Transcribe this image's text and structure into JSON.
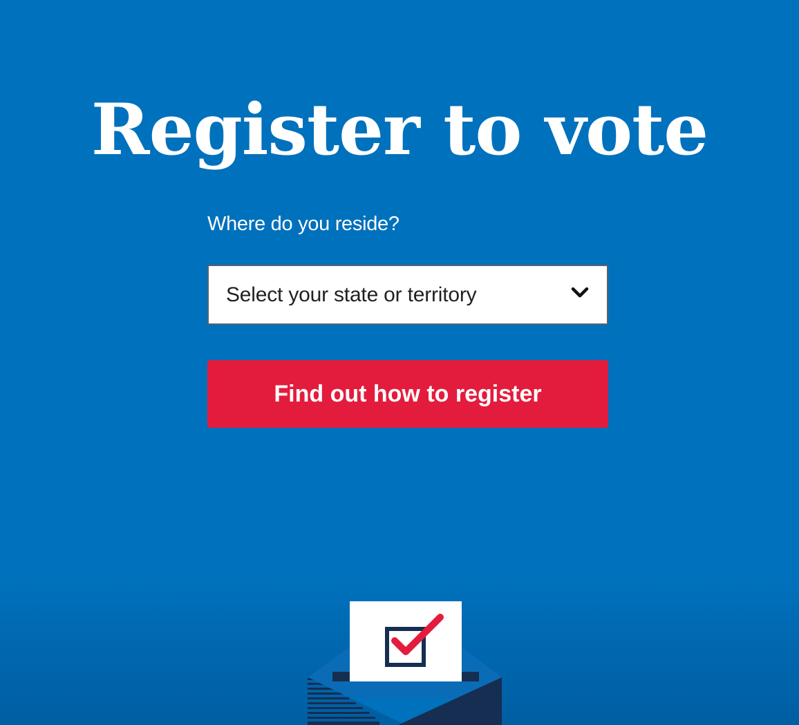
{
  "hero": {
    "title": "Register to vote"
  },
  "form": {
    "reside_label": "Where do you reside?",
    "state_select": {
      "selected_text": "Select your state or territory",
      "icon": "chevron-down-icon"
    },
    "submit_label": "Find out how to register"
  },
  "illustration": {
    "name": "ballot-box-illustration",
    "icons": [
      "checkbox-icon",
      "checkmark-icon"
    ]
  },
  "colors": {
    "background": "#0071bc",
    "button": "#e31c3d",
    "select_bg": "#ffffff",
    "ballot_dark": "#162e51",
    "checkmark": "#e31c3d"
  }
}
